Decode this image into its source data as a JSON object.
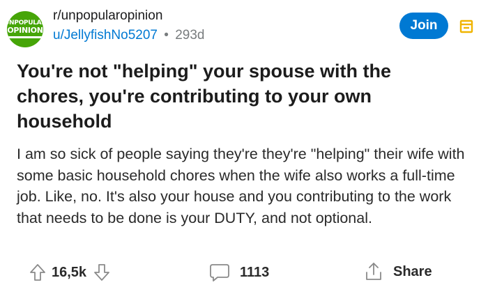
{
  "post": {
    "subreddit": "r/unpopularopinion",
    "author": "u/JellyfishNo5207",
    "separator": "•",
    "age": "293d",
    "subreddit_icon": {
      "line1": "UNPOPULAR",
      "line2": "OPINION",
      "color": "#46a508"
    },
    "join_label": "Join",
    "title": "You're not \"helping\" your spouse with the chores, you're contributing to your own household",
    "body": "I am so sick of people saying they're they're \"helping\" their wife with some basic household chores when the wife also works a full-time job. Like, no. It's also your house and you contributing to the work that needs to be done is your DUTY, and not optional."
  },
  "actions": {
    "score": "16,5k",
    "comments": "1113",
    "share_label": "Share"
  },
  "icons": {
    "upvote": "upvote-arrow-icon",
    "downvote": "downvote-arrow-icon",
    "comment": "comment-bubble-icon",
    "share": "share-icon",
    "menu": "post-menu-icon"
  },
  "colors": {
    "accent": "#0079d3",
    "menu_icon": "#f0b400",
    "icon_gray": "#8a8a8a"
  }
}
